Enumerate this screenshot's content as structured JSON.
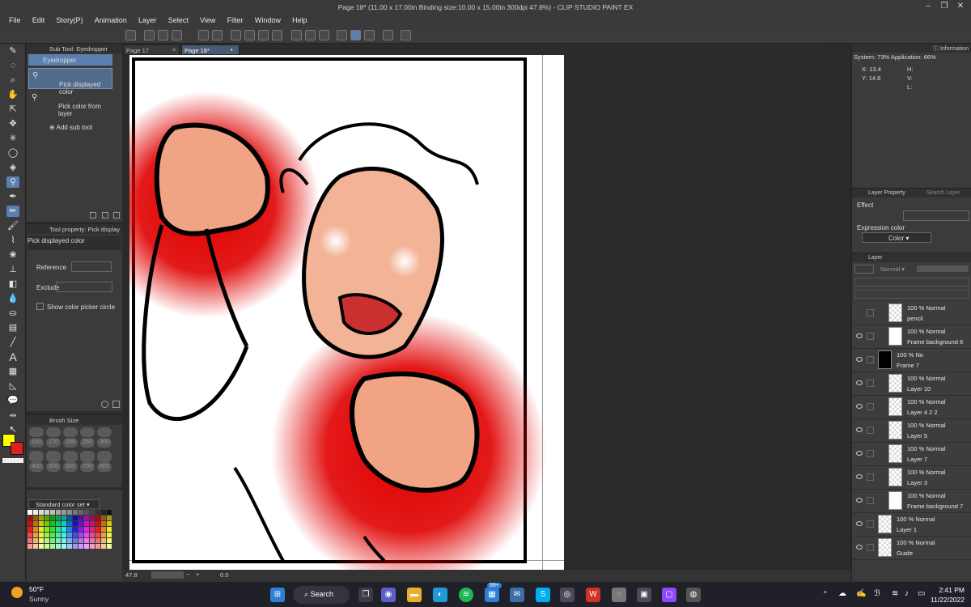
{
  "window": {
    "title": "Page 18* (11.00 x 17.00in Binding size:10.00 x 15.00in 300dpi 47.8%) - CLIP STUDIO PAINT EX"
  },
  "menu": [
    "File",
    "Edit",
    "Story(P)",
    "Animation",
    "Layer",
    "Select",
    "View",
    "Filter",
    "Window",
    "Help"
  ],
  "tabs": [
    {
      "label": "Page 17"
    },
    {
      "label": "Page 18*"
    }
  ],
  "subtool": {
    "header": "Sub Tool: Eyedropper",
    "group": "Eyedropper",
    "items": [
      "Pick displayed color",
      "Pick color from layer"
    ],
    "add": "Add sub tool"
  },
  "tool_property": {
    "header": "Tool property: Pick display",
    "name": "Pick displayed color",
    "reference_label": "Reference",
    "exclude_label": "Exclude",
    "checkbox_label": "Show color picker circle"
  },
  "brush_size": {
    "header": "Brush Size",
    "sizes": [
      "150",
      "170",
      "200",
      "250",
      "300",
      "400",
      "500",
      "600",
      "700",
      "800"
    ]
  },
  "color_set": {
    "label": "Standard color set"
  },
  "info": {
    "header": "Information",
    "system": "System: 73%  Application: 66%",
    "x": "X: 13.4",
    "y": "Y: 14.8",
    "h": "H:",
    "v": "V:",
    "l": "L:"
  },
  "layer_property": {
    "header": "Layer Property",
    "search_tab": "Search Layer",
    "effect_label": "Effect",
    "expression_label": "Expression color",
    "expression_value": "Color"
  },
  "layer_panel": {
    "header": "Layer",
    "blend_mode": "Normal",
    "layers": [
      {
        "blend": "100 % Normal",
        "name": "pencil",
        "indent": 1,
        "thumb": "chk",
        "eye": false
      },
      {
        "blend": "100 % Normal",
        "name": "Frame background 6",
        "indent": 1,
        "thumb": "white",
        "eye": true
      },
      {
        "blend": "100 % No",
        "name": "Frame 7",
        "indent": 0,
        "thumb": "black",
        "eye": true
      },
      {
        "blend": "100 % Normal",
        "name": "Layer 10",
        "indent": 1,
        "thumb": "chk",
        "eye": true
      },
      {
        "blend": "100 % Normal",
        "name": "Layer 4 2 2",
        "indent": 1,
        "thumb": "chk",
        "eye": true
      },
      {
        "blend": "100 % Normal",
        "name": "Layer 5",
        "indent": 1,
        "thumb": "chk",
        "eye": true
      },
      {
        "blend": "100 % Normal",
        "name": "Layer 7",
        "indent": 1,
        "thumb": "chk",
        "eye": true
      },
      {
        "blend": "100 % Normal",
        "name": "Layer 3",
        "indent": 1,
        "thumb": "chk",
        "eye": true
      },
      {
        "blend": "100 % Normal",
        "name": "Frame background 7",
        "indent": 1,
        "thumb": "white",
        "eye": true
      },
      {
        "blend": "100 % Normal",
        "name": "Layer 1",
        "indent": 0,
        "thumb": "chk",
        "eye": true
      },
      {
        "blend": "100 % Normal",
        "name": "Guide",
        "indent": 0,
        "thumb": "chk",
        "eye": true
      }
    ]
  },
  "status": {
    "zoom": "47.8",
    "rotation": "0.0"
  },
  "taskbar": {
    "weather_temp": "50°F",
    "weather_desc": "Sunny",
    "search": "Search",
    "badge": "99+",
    "time": "2:41 PM",
    "date": "11/22/2022"
  },
  "colors": {
    "main": "#ffff00",
    "sub": "#e02020",
    "accent": "#5b7fb0"
  }
}
